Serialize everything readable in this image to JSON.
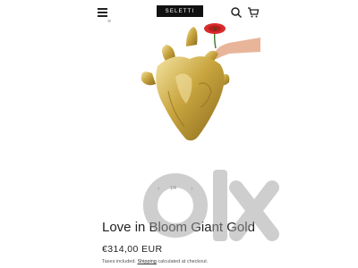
{
  "header": {
    "brand": "SELETTI",
    "menu_icon": "hamburger-icon",
    "search_icon": "search-icon",
    "cart_icon": "cart-icon"
  },
  "gallery": {
    "image_subject": "gold heart-shaped vase holding a red gerbera flower",
    "counter": "1/4",
    "prev_icon": "chevron-left-icon",
    "next_icon": "chevron-right-icon"
  },
  "product": {
    "title": "Love in Bloom Giant Gold",
    "price": "€314,00 EUR",
    "tax_prefix": "Taxes included.",
    "shipping_link": "Shipping",
    "tax_suffix": "calculated at checkout."
  },
  "watermark": {
    "text": "olx"
  },
  "colors": {
    "gold": "#c9a53f",
    "flower": "#d82b2b",
    "header_logo_bg": "#111111"
  }
}
